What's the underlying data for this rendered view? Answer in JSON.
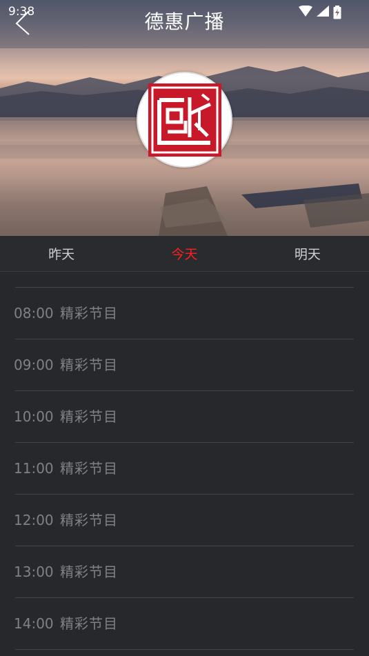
{
  "status_bar": {
    "time": "9:38",
    "icons": [
      "wifi-icon",
      "signal-icon",
      "battery-icon"
    ]
  },
  "header": {
    "title": "德惠广播",
    "back_icon": "back-chevron-icon",
    "logo": "station-seal-logo"
  },
  "tabs": [
    {
      "label": "昨天",
      "active": false
    },
    {
      "label": "今天",
      "active": true
    },
    {
      "label": "明天",
      "active": false
    }
  ],
  "schedule": [
    {
      "time": "08:00",
      "program": "精彩节目"
    },
    {
      "time": "09:00",
      "program": "精彩节目"
    },
    {
      "time": "10:00",
      "program": "精彩节目"
    },
    {
      "time": "11:00",
      "program": "精彩节目"
    },
    {
      "time": "12:00",
      "program": "精彩节目"
    },
    {
      "time": "13:00",
      "program": "精彩节目"
    },
    {
      "time": "14:00",
      "program": "精彩节目"
    }
  ],
  "colors": {
    "background": "#27282c",
    "active_tab": "#ff2020",
    "tab_text": "#cfd0d3",
    "row_text": "#808186",
    "divider": "#44454a",
    "logo_red": "#c8192a"
  }
}
